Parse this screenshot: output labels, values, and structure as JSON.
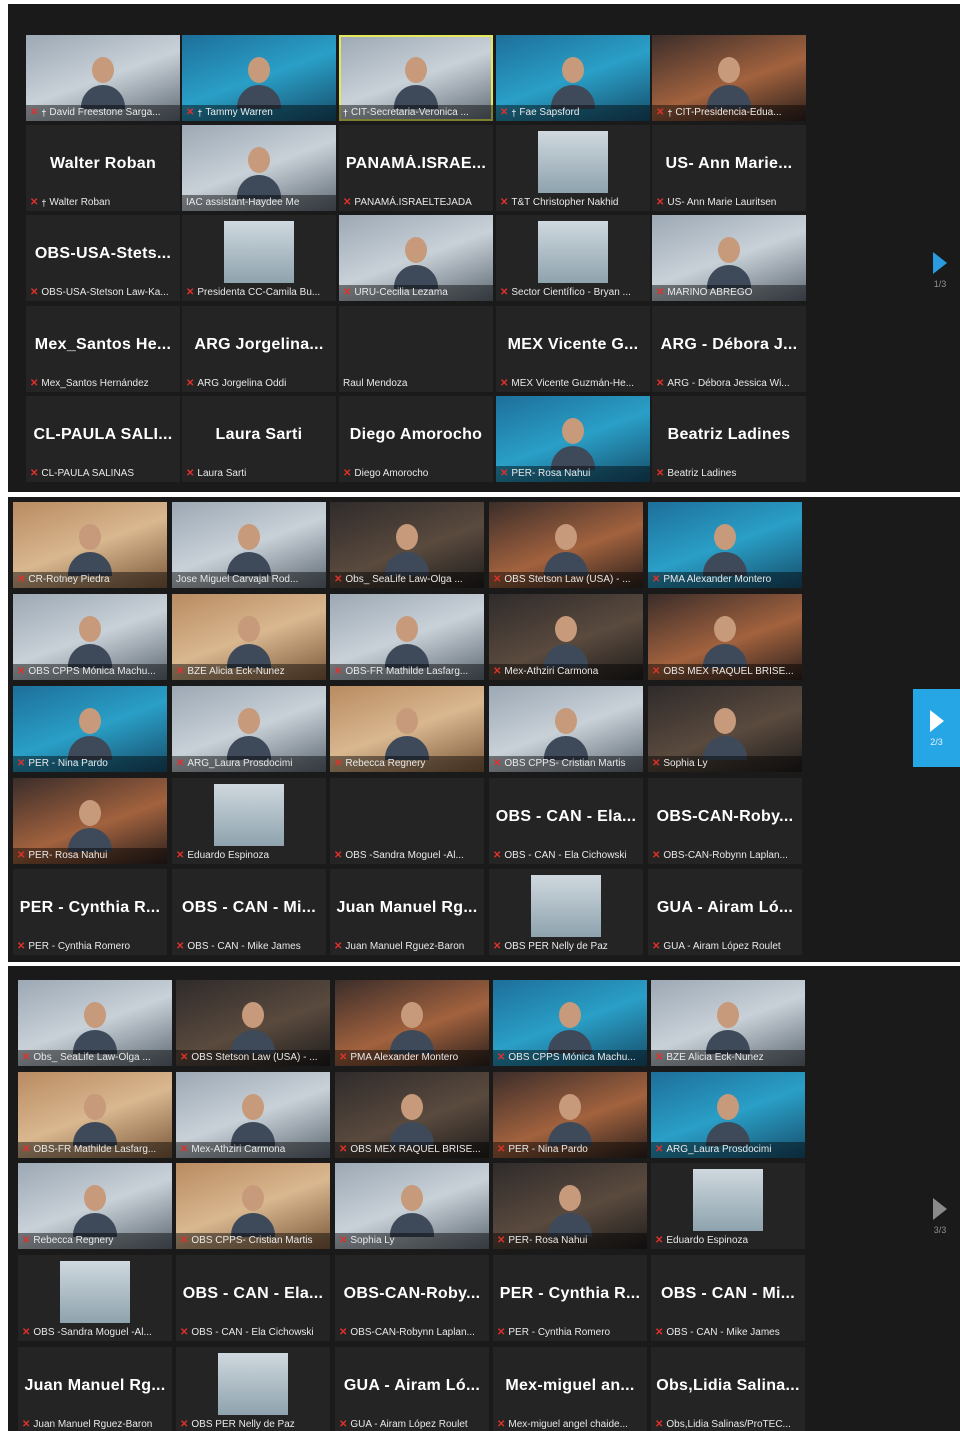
{
  "colors": {
    "panel_bg": "#1a1a1a",
    "tile_bg": "#242424",
    "mic_muted": "#e0312a",
    "active_speaker": "#e4e85a",
    "next_accent": "#27a6e5"
  },
  "panels": [
    {
      "page": "1/3",
      "tiles": [
        {
          "name": "David Freestone Sarga...",
          "video": true,
          "muted": true,
          "pinned": true
        },
        {
          "name": "Tammy Warren",
          "video": true,
          "muted": true,
          "pinned": true
        },
        {
          "name": "CIT-Secretaria-Veronica ...",
          "video": true,
          "muted": false,
          "pinned": true,
          "active": true
        },
        {
          "name": "Fae Sapsford",
          "video": true,
          "muted": true,
          "pinned": true
        },
        {
          "name": "CIT-Presidencia-Edua...",
          "video": true,
          "muted": true,
          "pinned": true
        },
        {
          "name": "Walter Roban",
          "big": "Walter Roban",
          "video": false,
          "muted": true,
          "pinned": true
        },
        {
          "name": "IAC assistant-Haydee Me",
          "video": true,
          "muted": false,
          "logo": "20"
        },
        {
          "name": "PANAMÁ.ISRAELTEJADA",
          "big": "PANAMÁ.ISRAE...",
          "video": false,
          "muted": true
        },
        {
          "name": "T&T Christopher Nakhid",
          "video": false,
          "muted": true,
          "thumb": true
        },
        {
          "name": "US- Ann Marie Lauritsen",
          "big": "US- Ann Marie...",
          "video": false,
          "muted": true
        },
        {
          "name": "OBS-USA-Stetson Law-Ka...",
          "big": "OBS-USA-Stets...",
          "video": false,
          "muted": true
        },
        {
          "name": "Presidenta CC-Camila Bu...",
          "video": false,
          "muted": true,
          "thumb": true
        },
        {
          "name": "URU-Cecilia Lezama",
          "video": true,
          "muted": true
        },
        {
          "name": "Sector Científico - Bryan ...",
          "video": false,
          "muted": true,
          "thumb": true
        },
        {
          "name": "MARINO ABREGO",
          "video": true,
          "muted": true
        },
        {
          "name": "Mex_Santos Hernández",
          "big": "Mex_Santos He...",
          "video": false,
          "muted": true
        },
        {
          "name": "ARG Jorgelina Oddi",
          "big": "ARG Jorgelina...",
          "video": false,
          "muted": true
        },
        {
          "name": "Raul Mendoza",
          "video": false,
          "muted": false
        },
        {
          "name": "MEX Vicente Guzmán-He...",
          "big": "MEX Vicente G...",
          "video": false,
          "muted": true
        },
        {
          "name": "ARG - Débora Jessica Wi...",
          "big": "ARG - Débora J...",
          "video": false,
          "muted": true
        },
        {
          "name": "CL-PAULA SALINAS",
          "big": "CL-PAULA SALI...",
          "video": false,
          "muted": true
        },
        {
          "name": "Laura Sarti",
          "big": "Laura Sarti",
          "video": false,
          "muted": true
        },
        {
          "name": "Diego Amorocho",
          "big": "Diego Amorocho",
          "video": false,
          "muted": true
        },
        {
          "name": "PER- Rosa Nahui",
          "video": true,
          "muted": true
        },
        {
          "name": "Beatriz Ladines",
          "big": "Beatriz Ladines",
          "video": false,
          "muted": true
        }
      ]
    },
    {
      "page": "2/3",
      "tiles": [
        {
          "name": "CR-Rotney Piedra",
          "video": true,
          "muted": true
        },
        {
          "name": "Jose Miguel Carvajal Rod...",
          "video": true,
          "muted": false
        },
        {
          "name": "Obs_ SeaLife Law-Olga ...",
          "video": true,
          "muted": true
        },
        {
          "name": "OBS Stetson Law (USA) - ...",
          "video": true,
          "muted": true
        },
        {
          "name": "PMA Alexander Montero",
          "video": true,
          "muted": true
        },
        {
          "name": "OBS CPPS Mónica Machu...",
          "video": true,
          "muted": true
        },
        {
          "name": "BZE Alicia Eck-Nunez",
          "video": true,
          "muted": true
        },
        {
          "name": "OBS-FR Mathilde Lasfarg...",
          "video": true,
          "muted": true
        },
        {
          "name": "Mex-Athziri Carmona",
          "video": true,
          "muted": true
        },
        {
          "name": "OBS MEX RAQUEL BRISE...",
          "video": true,
          "muted": true
        },
        {
          "name": "PER - Nina Pardo",
          "video": true,
          "muted": true
        },
        {
          "name": "ARG_Laura Prosdocimi",
          "video": true,
          "muted": true
        },
        {
          "name": "Rebecca Regnery",
          "video": true,
          "muted": true
        },
        {
          "name": "OBS CPPS- Cristian Martis",
          "video": true,
          "muted": true
        },
        {
          "name": "Sophia Ly",
          "video": true,
          "muted": true
        },
        {
          "name": "PER- Rosa Nahui",
          "video": true,
          "muted": true
        },
        {
          "name": "Eduardo Espinoza",
          "video": false,
          "muted": true,
          "thumb": true
        },
        {
          "name": "OBS -Sandra Moguel -Al...",
          "video": false,
          "muted": true
        },
        {
          "name": "OBS - CAN - Ela Cichowski",
          "big": "OBS - CAN - Ela...",
          "video": false,
          "muted": true
        },
        {
          "name": "OBS-CAN-Robynn Laplan...",
          "big": "OBS-CAN-Roby...",
          "video": false,
          "muted": true
        },
        {
          "name": "PER - Cynthia Romero",
          "big": "PER - Cynthia R...",
          "video": false,
          "muted": true
        },
        {
          "name": "OBS - CAN - Mike James",
          "big": "OBS - CAN - Mi...",
          "video": false,
          "muted": true
        },
        {
          "name": "Juan Manuel Rguez-Baron",
          "big": "Juan Manuel Rg...",
          "video": false,
          "muted": true
        },
        {
          "name": "OBS PER Nelly de Paz",
          "video": false,
          "muted": true,
          "thumb": true
        },
        {
          "name": "GUA - Airam López Roulet",
          "big": "GUA - Airam Ló...",
          "video": false,
          "muted": true
        }
      ]
    },
    {
      "page": "3/3",
      "tiles": [
        {
          "name": "Obs_ SeaLife Law-Olga ...",
          "video": true,
          "muted": true
        },
        {
          "name": "OBS Stetson Law (USA) - ...",
          "video": true,
          "muted": true
        },
        {
          "name": "PMA Alexander Montero",
          "video": true,
          "muted": true
        },
        {
          "name": "OBS CPPS Mónica Machu...",
          "video": true,
          "muted": true
        },
        {
          "name": "BZE Alicia Eck-Nunez",
          "video": true,
          "muted": true
        },
        {
          "name": "OBS-FR Mathilde Lasfarg...",
          "video": true,
          "muted": true
        },
        {
          "name": "Mex-Athziri Carmona",
          "video": true,
          "muted": true
        },
        {
          "name": "OBS MEX RAQUEL BRISE...",
          "video": true,
          "muted": true
        },
        {
          "name": "PER - Nina Pardo",
          "video": true,
          "muted": true
        },
        {
          "name": "ARG_Laura Prosdocimi",
          "video": true,
          "muted": true
        },
        {
          "name": "Rebecca Regnery",
          "video": true,
          "muted": true
        },
        {
          "name": "OBS CPPS- Cristian Martis",
          "video": true,
          "muted": true
        },
        {
          "name": "Sophia Ly",
          "video": true,
          "muted": true
        },
        {
          "name": "PER- Rosa Nahui",
          "video": true,
          "muted": true
        },
        {
          "name": "Eduardo Espinoza",
          "video": false,
          "muted": true,
          "thumb": true
        },
        {
          "name": "OBS -Sandra Moguel -Al...",
          "video": false,
          "muted": true,
          "thumb": true
        },
        {
          "name": "OBS - CAN - Ela Cichowski",
          "big": "OBS - CAN - Ela...",
          "video": false,
          "muted": true
        },
        {
          "name": "OBS-CAN-Robynn Laplan...",
          "big": "OBS-CAN-Roby...",
          "video": false,
          "muted": true
        },
        {
          "name": "PER - Cynthia Romero",
          "big": "PER - Cynthia R...",
          "video": false,
          "muted": true
        },
        {
          "name": "OBS - CAN - Mike James",
          "big": "OBS - CAN - Mi...",
          "video": false,
          "muted": true
        },
        {
          "name": "Juan Manuel Rguez-Baron",
          "big": "Juan Manuel Rg...",
          "video": false,
          "muted": true
        },
        {
          "name": "OBS PER Nelly de Paz",
          "video": false,
          "muted": true,
          "thumb": true
        },
        {
          "name": "GUA - Airam López Roulet",
          "big": "GUA - Airam Ló...",
          "video": false,
          "muted": true
        },
        {
          "name": "Mex-miguel angel chaide...",
          "big": "Mex-miguel an...",
          "video": false,
          "muted": true
        },
        {
          "name": "Obs,Lidia Salinas/ProTEC...",
          "big": "Obs,Lidia Salina...",
          "video": false,
          "muted": true
        }
      ]
    }
  ]
}
